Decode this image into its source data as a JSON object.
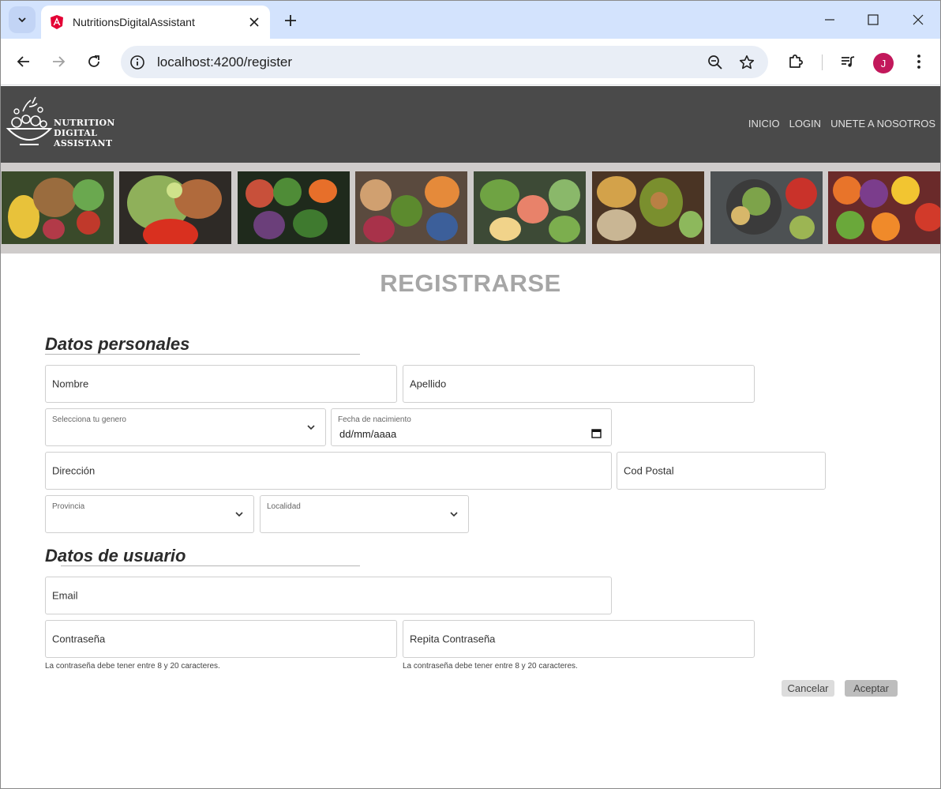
{
  "browser": {
    "tab_title": "NutritionsDigitalAssistant",
    "url": "localhost:4200/register",
    "avatar_initial": "J"
  },
  "site": {
    "logo_lines": [
      "NUTRITION",
      "DIGITAL",
      "ASSISTANT"
    ],
    "nav": [
      "INICIO",
      "LOGIN",
      "UNETE A NOSOTROS"
    ]
  },
  "banner_images": [
    "food-image-1",
    "food-image-2",
    "food-image-3",
    "food-image-4",
    "food-image-5",
    "food-image-6",
    "food-image-7",
    "food-image-8"
  ],
  "form": {
    "title": "REGISTRARSE",
    "personal_section": "Datos personales",
    "user_section": "Datos de usuario",
    "nombre": "Nombre",
    "apellido": "Apellido",
    "genero_label": "Selecciona tu genero",
    "fecha_label": "Fecha de nacimiento",
    "fecha_value": "dd/mm/aaaa",
    "direccion": "Dirección",
    "cod_postal": "Cod Postal",
    "provincia_label": "Provincia",
    "localidad_label": "Localidad",
    "email": "Email",
    "password": "Contraseña",
    "password_repeat": "Repita Contraseña",
    "password_hint": "La contraseña debe tener entre 8 y 20 caracteres.",
    "password_repeat_hint": "La contraseña debe tener entre 8 y 20 caracteres.",
    "cancel": "Cancelar",
    "accept": "Aceptar"
  }
}
